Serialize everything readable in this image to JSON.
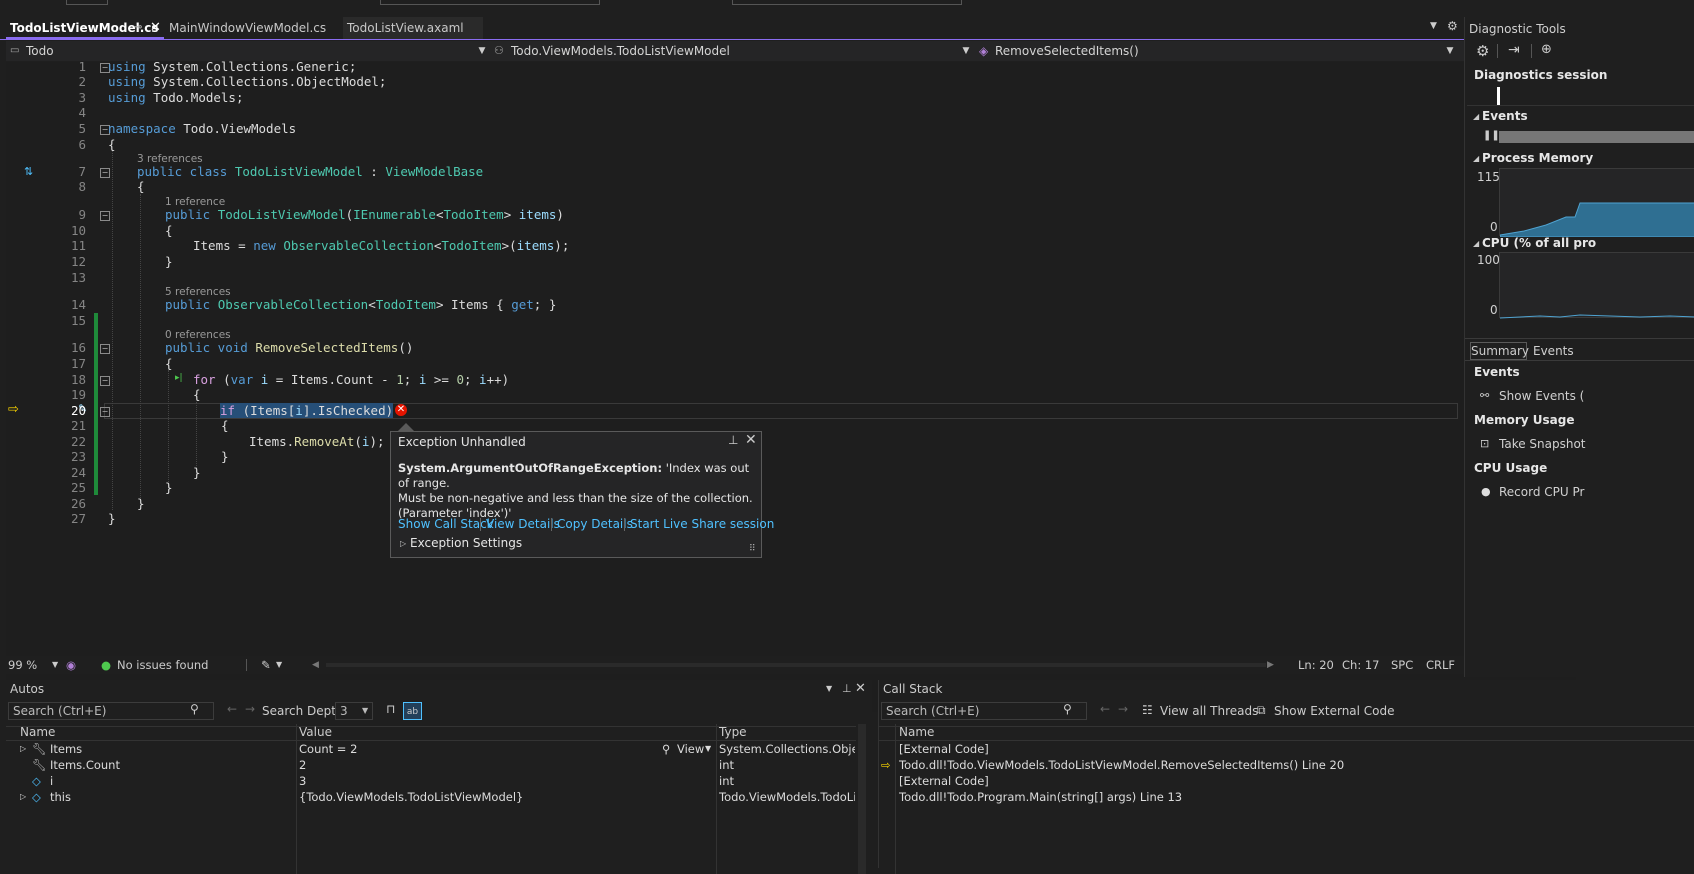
{
  "tabs": [
    {
      "label": "TodoListViewModel.cs",
      "active": true
    },
    {
      "label": "MainWindowViewModel.cs",
      "active": false
    },
    {
      "label": "TodoListView.axaml",
      "active": false
    }
  ],
  "nav": {
    "project": "Todo",
    "class": "Todo.ViewModels.TodoListViewModel",
    "member": "RemoveSelectedItems()"
  },
  "code": {
    "current_line": 20,
    "refs": {
      "r7": "3 references",
      "r9": "1 reference",
      "r14": "5 references",
      "r16": "0 references"
    },
    "lines": {
      "l1": [
        "using",
        " System.Collections.Generic;"
      ],
      "l2": [
        "using",
        " System.Collections.ObjectModel;"
      ],
      "l3": [
        "using",
        " Todo.Models;"
      ],
      "l5": [
        "namespace",
        " Todo.ViewModels"
      ],
      "l6": "{",
      "l7": [
        "public class ",
        "TodoListViewModel",
        " : ",
        "ViewModelBase"
      ],
      "l8": "{",
      "l9": [
        "public ",
        "TodoListViewModel",
        "(",
        "IEnumerable",
        "<",
        "TodoItem",
        "> ",
        "items",
        ")"
      ],
      "l10": "{",
      "l11": [
        "Items = ",
        "new ",
        "ObservableCollection",
        "<",
        "TodoItem",
        ">(",
        "items",
        ");"
      ],
      "l12": "}",
      "l14": [
        "public ",
        "ObservableCollection",
        "<",
        "TodoItem",
        "> Items { ",
        "get",
        "; }"
      ],
      "l16": [
        "public void ",
        "RemoveSelectedItems",
        "()"
      ],
      "l17": "{",
      "l18": [
        "for",
        " (",
        "var ",
        "i",
        " = Items.Count - ",
        "1",
        "; ",
        "i",
        " >= ",
        "0",
        "; ",
        "i",
        "++)"
      ],
      "l19": "{",
      "l20": [
        "if",
        " (Items[",
        "i",
        "].IsChecked)"
      ],
      "l21": "{",
      "l22": [
        "Items.",
        "RemoveAt",
        "(",
        "i",
        ");"
      ],
      "l23": "}",
      "l24": "}",
      "l25": "}",
      "l26": "}",
      "l27": "}"
    }
  },
  "exception": {
    "title": "Exception Unhandled",
    "type": "System.ArgumentOutOfRangeException:",
    "message_1": " 'Index was out of range.",
    "message_2": "Must be non-negative and less than the size of the collection.",
    "message_3": "(Parameter 'index')'",
    "links": [
      "Show Call Stack",
      "View Details",
      "Copy Details",
      "Start Live Share session"
    ],
    "settings": "Exception Settings"
  },
  "status": {
    "zoom": "99 %",
    "issues": "No issues found",
    "ln": "Ln: 20",
    "ch": "Ch: 17",
    "spc": "SPC",
    "crlf": "CRLF"
  },
  "autos": {
    "title": "Autos",
    "search": "Search (Ctrl+E)",
    "depth_label": "Search Depth:",
    "depth": "3",
    "columns": [
      "Name",
      "Value",
      "Type"
    ],
    "view_label": "View",
    "rows": [
      {
        "name": "Items",
        "value": "Count = 2",
        "type": "System.Collections.Objec..."
      },
      {
        "name": "Items.Count",
        "value": "2",
        "type": "int"
      },
      {
        "name": "i",
        "value": "3",
        "type": "int"
      },
      {
        "name": "this",
        "value": "{Todo.ViewModels.TodoListViewModel}",
        "type": "Todo.ViewModels.TodoLis..."
      }
    ]
  },
  "callstack": {
    "title": "Call Stack",
    "search": "Search (Ctrl+E)",
    "view_threads": "View all Threads",
    "show_external": "Show External Code",
    "column": "Name",
    "rows": [
      "[External Code]",
      "Todo.dll!Todo.ViewModels.TodoListViewModel.RemoveSelectedItems() Line 20",
      "[External Code]",
      "Todo.dll!Todo.Program.Main(string[] args) Line 13"
    ]
  },
  "diag": {
    "title": "Diagnostic Tools",
    "sessions": "Diagnostics session",
    "events": "Events",
    "process_memory": "Process Memory",
    "mem_max": "115",
    "mem_min": "0",
    "cpu": "CPU (% of all pro",
    "cpu_max": "100",
    "cpu_min": "0",
    "tabs": [
      "Summary",
      "Events"
    ],
    "sec_events": "Events",
    "show_events": "Show Events (",
    "sec_memory": "Memory Usage",
    "take_snapshot": "Take Snapshot",
    "sec_cpu": "CPU Usage",
    "record_cpu": "Record CPU Pr"
  },
  "colors": {
    "accent": "#8a6cf0",
    "link": "#4fc1ff",
    "error": "#e51400",
    "green": "#1f8a3a"
  }
}
